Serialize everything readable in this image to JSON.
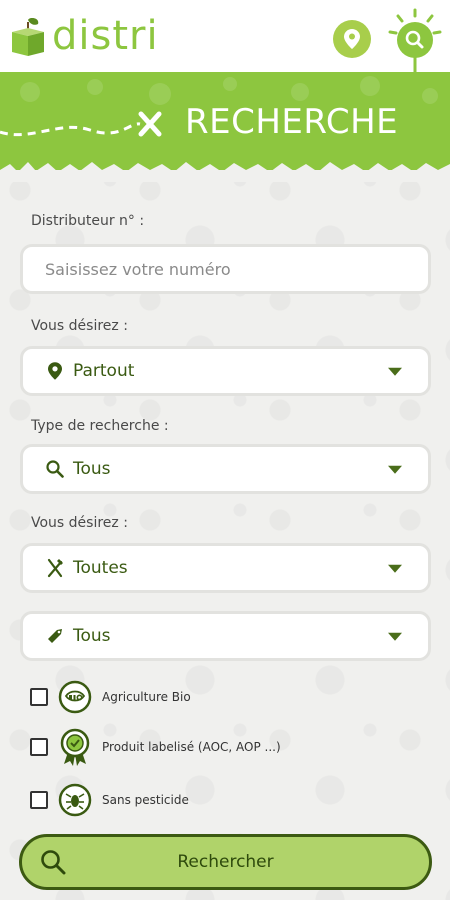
{
  "header": {
    "logo_text": "distri",
    "location_button": "location-pin-icon",
    "search_button": "search-icon"
  },
  "banner": {
    "title": "RECHERCHE"
  },
  "form": {
    "distributor": {
      "label": "Distributeur n° :",
      "placeholder": "Saisissez votre numéro",
      "value": ""
    },
    "where": {
      "label": "Vous désirez :",
      "icon": "location-pin-icon",
      "value": "Partout"
    },
    "search_type": {
      "label": "Type de recherche :",
      "icon": "search-icon",
      "value": "Tous"
    },
    "wish": {
      "label": "Vous désirez :",
      "icon": "fork-knife-icon",
      "value": "Toutes"
    },
    "tag": {
      "icon": "tag-icon",
      "value": "Tous"
    },
    "checkboxes": [
      {
        "label": "Agriculture Bio",
        "icon": "bio-badge-icon",
        "checked": false
      },
      {
        "label": "Produit labelisé (AOC, AOP ...)",
        "icon": "label-ribbon-icon",
        "checked": false
      },
      {
        "label": "Sans pesticide",
        "icon": "no-pesticide-icon",
        "checked": false
      }
    ],
    "submit_label": "Rechercher"
  },
  "colors": {
    "brand_green": "#8dc63f",
    "light_green": "#b0d36a",
    "dark_green": "#3c5a12"
  }
}
